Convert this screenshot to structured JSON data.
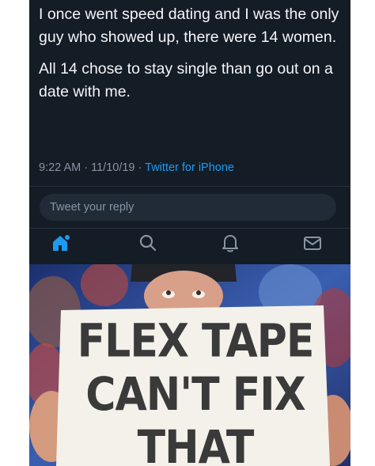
{
  "tweet": {
    "paragraphs": [
      "I once went speed dating and I was the only guy who showed up, there were 14 women.",
      "All 14 chose to stay single than go out on a date with me."
    ],
    "time": "9:22 AM",
    "date": "11/10/19",
    "separator": "·",
    "source": "Twitter for iPhone"
  },
  "reply": {
    "placeholder": "Tweet your reply"
  },
  "nav": [
    "home-icon",
    "search-icon",
    "notifications-icon",
    "messages-icon"
  ],
  "photo": {
    "sign_lines": [
      "FLEX TAPE",
      "CAN'T FIX",
      "THAT"
    ]
  },
  "colors": {
    "panel": "#141c26",
    "accent": "#1d9bf0",
    "meta": "#8795a2"
  }
}
